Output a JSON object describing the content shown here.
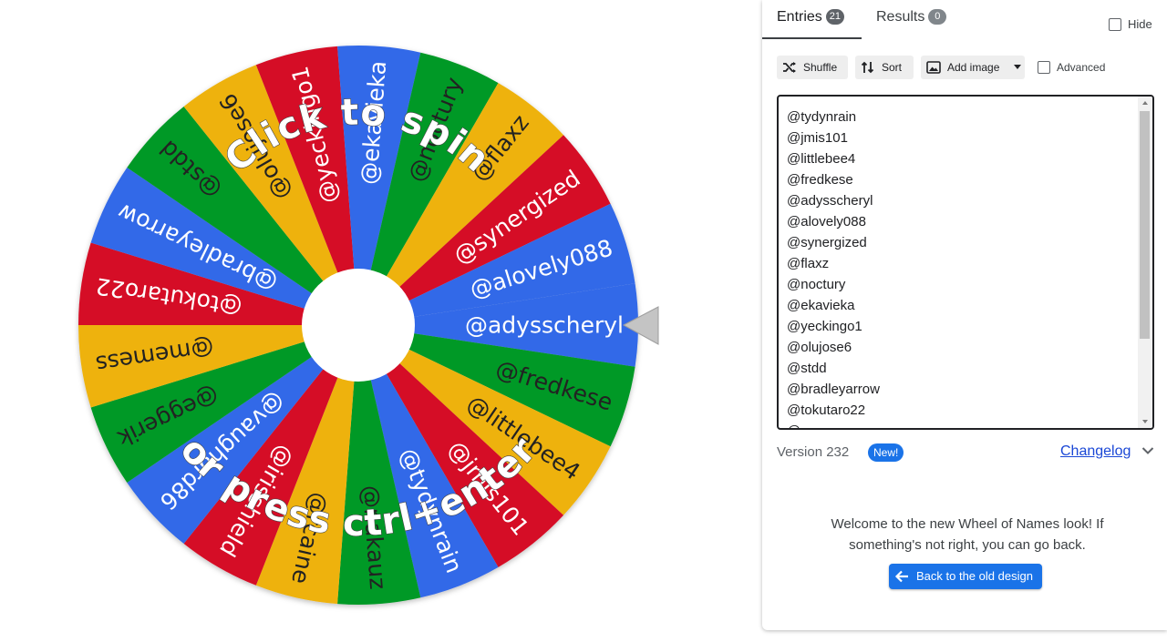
{
  "wheel": {
    "entries_clockwise_from_pointer": [
      "@adysscheryl",
      "@fredkese",
      "@littlebee4",
      "@jmis101",
      "@tydynrain",
      "@nakauz",
      "@rcaine",
      "@irisshield",
      "@vaughard86",
      "@eggerik",
      "@memess",
      "@tokutaro22",
      "@bradleyarrow",
      "@stdd",
      "@olujose6",
      "@yeckingo1",
      "@ekavieka",
      "@noctury",
      "@flaxz",
      "@synergized",
      "@alovely088"
    ],
    "colors": [
      "#3369e8",
      "#009925",
      "#eeb211",
      "#d50f25"
    ],
    "center_color": "#ffffff",
    "pointer_color": "#c4c4c4",
    "prompt_top": "Click to spin",
    "prompt_bottom": "or press ctrl+enter"
  },
  "panel": {
    "tabs": {
      "entries_label": "Entries",
      "entries_count": "21",
      "results_label": "Results",
      "results_count": "0"
    },
    "hide_label": "Hide",
    "toolbar": {
      "shuffle_label": "Shuffle",
      "sort_label": "Sort",
      "add_image_label": "Add image",
      "advanced_label": "Advanced"
    },
    "entries_text": [
      "@tydynrain",
      "@jmis101",
      "@littlebee4",
      "@fredkese",
      "@adysscheryl",
      "@alovely088",
      "@synergized",
      "@flaxz",
      "@noctury",
      "@ekavieka",
      "@yeckingo1",
      "@olujose6",
      "@stdd",
      "@bradleyarrow",
      "@tokutaro22",
      "@memess"
    ],
    "version_label": "Version 232",
    "new_badge": "New!",
    "changelog_label": "Changelog",
    "welcome_text": "Welcome to the new Wheel of Names look! If something's not right, you can go back.",
    "back_button_label": "Back to the old design"
  }
}
